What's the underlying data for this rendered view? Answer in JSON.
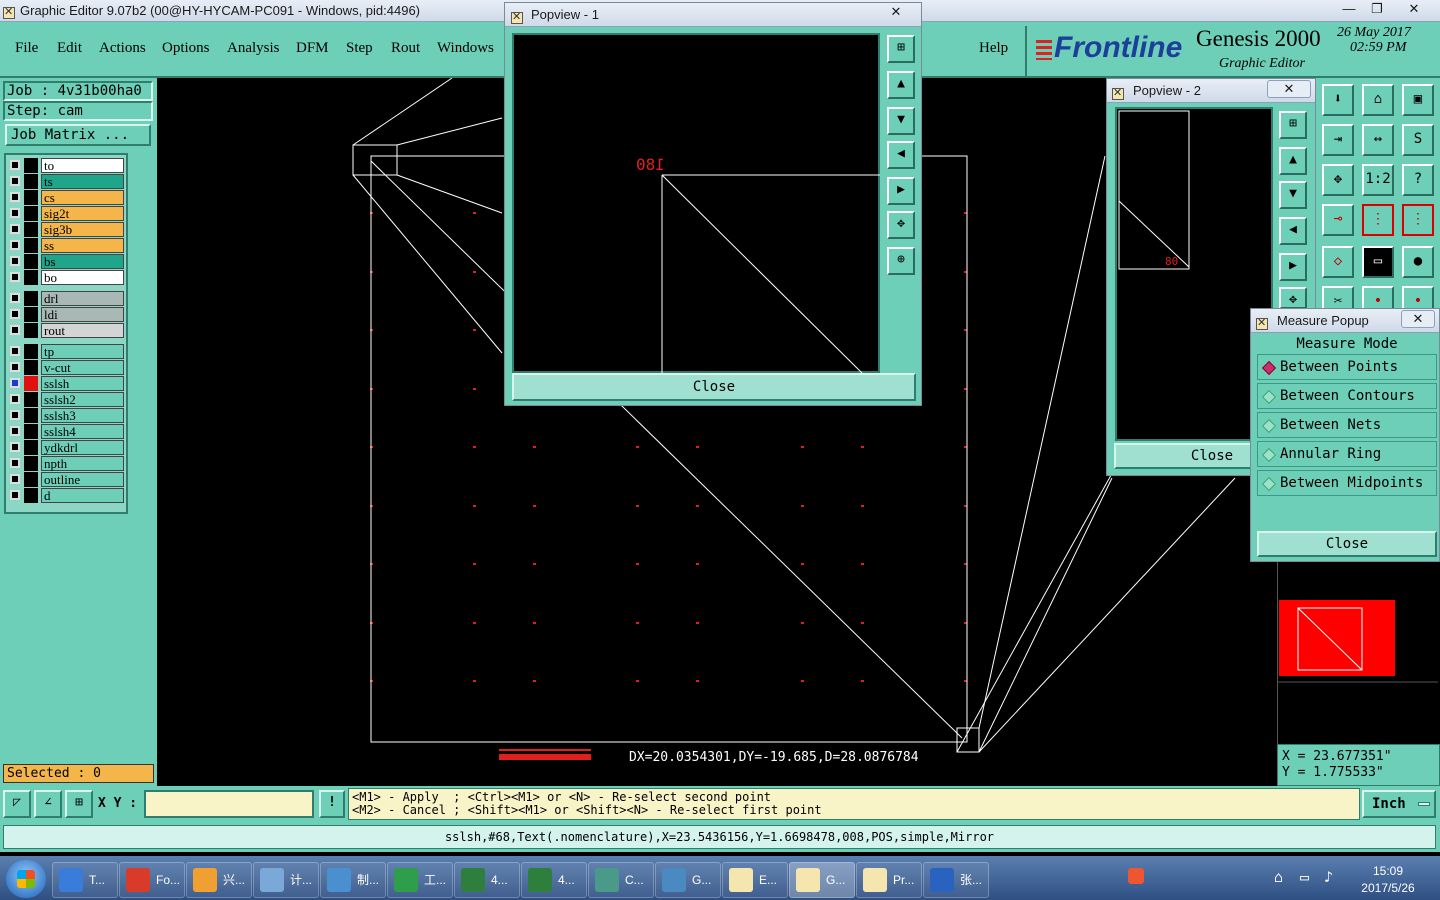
{
  "app": {
    "title": "Graphic Editor 9.07b2 (00@HY-HYCAM-PC091 - Windows, pid:4496)"
  },
  "menu": {
    "items": [
      "File",
      "Edit",
      "Actions",
      "Options",
      "Analysis",
      "DFM",
      "Step",
      "Rout",
      "Windows"
    ],
    "help": "Help"
  },
  "brand": {
    "logo": "Frontline",
    "product": "Genesis 2000",
    "subtitle": "Graphic Editor",
    "date": "26 May 2017",
    "time": "02:59 PM"
  },
  "job": {
    "job_label": "Job : 4v31b00ha0",
    "step_label": "Step: cam",
    "matrix_button": "Job Matrix ..."
  },
  "layers": {
    "group1": [
      {
        "name": "to",
        "color": "#ffffff"
      },
      {
        "name": "ts",
        "color": "#1ea58a"
      },
      {
        "name": "cs",
        "color": "#f4b64a"
      },
      {
        "name": "sig2t",
        "color": "#f4b64a"
      },
      {
        "name": "sig3b",
        "color": "#f4b64a"
      },
      {
        "name": "ss",
        "color": "#f4b64a"
      },
      {
        "name": "bs",
        "color": "#1ea58a"
      },
      {
        "name": "bo",
        "color": "#ffffff"
      }
    ],
    "group2": [
      {
        "name": "drl",
        "color": "#a9b8b4"
      },
      {
        "name": "ldi",
        "color": "#a9b8b4"
      },
      {
        "name": "rout",
        "color": "#d4d4d4"
      }
    ],
    "group3": [
      {
        "name": "tp",
        "color": "#6ecfb8"
      },
      {
        "name": "v-cut",
        "color": "#6ecfb8"
      },
      {
        "name": "sslsh",
        "color": "#6ecfb8"
      },
      {
        "name": "sslsh2",
        "color": "#6ecfb8"
      },
      {
        "name": "sslsh3",
        "color": "#6ecfb8"
      },
      {
        "name": "sslsh4",
        "color": "#6ecfb8"
      },
      {
        "name": "ydkdrl",
        "color": "#6ecfb8"
      },
      {
        "name": "npth",
        "color": "#6ecfb8"
      },
      {
        "name": "outline",
        "color": "#6ecfb8"
      },
      {
        "name": "d",
        "color": "#6ecfb8"
      }
    ]
  },
  "selected_label": "Selected : 0",
  "measure_readout": "DX=20.0354301,DY=-19.685,D=28.0876784",
  "popview1": {
    "title": "Popview - 1",
    "label": "180",
    "close": "Close"
  },
  "popview2": {
    "title": "Popview - 2",
    "label": "80",
    "close": "Close"
  },
  "measure_popup": {
    "title": "Measure Popup",
    "header": "Measure Mode",
    "options": [
      "Between Points",
      "Between Contours",
      "Between Nets",
      "Annular Ring",
      "Between Midpoints"
    ],
    "selected": "Between Points",
    "close": "Close"
  },
  "coords": {
    "x": "X = 23.677351\"",
    "y": "Y = 1.775533\""
  },
  "command": {
    "xy_label": "X Y :",
    "xy_value": "",
    "line1": "<M1> - Apply  ; <Ctrl><M1> or <N> - Re-select second point",
    "line2": "<M2> - Cancel ; <Shift><M1> or <Shift><N> - Re-select first point",
    "units": "Inch"
  },
  "status_line": "sslsh,#68,Text(.nomenclature),X=23.5436156,Y=1.6698478,008,POS,simple,Mirror",
  "taskbar": {
    "items": [
      "T...",
      "Fo...",
      "兴...",
      "计...",
      "制...",
      "工...",
      "4...",
      "4...",
      "C...",
      "G...",
      "E...",
      "G...",
      "Pr...",
      "张..."
    ],
    "clock_time": "15:09",
    "clock_date": "2017/5/26"
  }
}
